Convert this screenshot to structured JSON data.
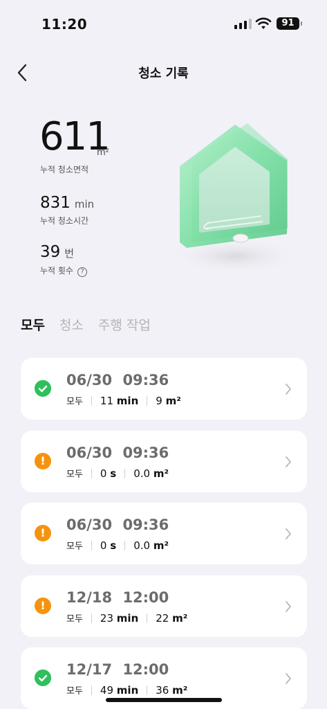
{
  "status_bar": {
    "time": "11:20",
    "battery": "91"
  },
  "header": {
    "title": "청소 기록"
  },
  "stats": {
    "area_value": "611",
    "area_unit": "m²",
    "area_label": "누적 청소면적",
    "time_value": "831",
    "time_unit": "min",
    "time_label": "누적 청소시간",
    "count_value": "39",
    "count_unit": "번",
    "count_label": "누적 횟수",
    "help_glyph": "?"
  },
  "tabs": [
    {
      "label": "모두",
      "active": true
    },
    {
      "label": "청소",
      "active": false
    },
    {
      "label": "주행 작업",
      "active": false
    }
  ],
  "records": [
    {
      "status": "success",
      "date": "06/30",
      "time": "09:36",
      "mode": "모두",
      "duration": "11",
      "duration_unit": "min",
      "area": "9",
      "area_unit": "m²"
    },
    {
      "status": "warning",
      "date": "06/30",
      "time": "09:36",
      "mode": "모두",
      "duration": "0",
      "duration_unit": "s",
      "area": "0.0",
      "area_unit": "m²"
    },
    {
      "status": "warning",
      "date": "06/30",
      "time": "09:36",
      "mode": "모두",
      "duration": "0",
      "duration_unit": "s",
      "area": "0.0",
      "area_unit": "m²"
    },
    {
      "status": "warning",
      "date": "12/18",
      "time": "12:00",
      "mode": "모두",
      "duration": "23",
      "duration_unit": "min",
      "area": "22",
      "area_unit": "m²"
    },
    {
      "status": "success",
      "date": "12/17",
      "time": "12:00",
      "mode": "모두",
      "duration": "49",
      "duration_unit": "min",
      "area": "36",
      "area_unit": "m²"
    }
  ],
  "colors": {
    "success": "#2fbf5c",
    "warning": "#f5930f",
    "house": "#7fe0a6",
    "background": "#f2f1f7"
  }
}
